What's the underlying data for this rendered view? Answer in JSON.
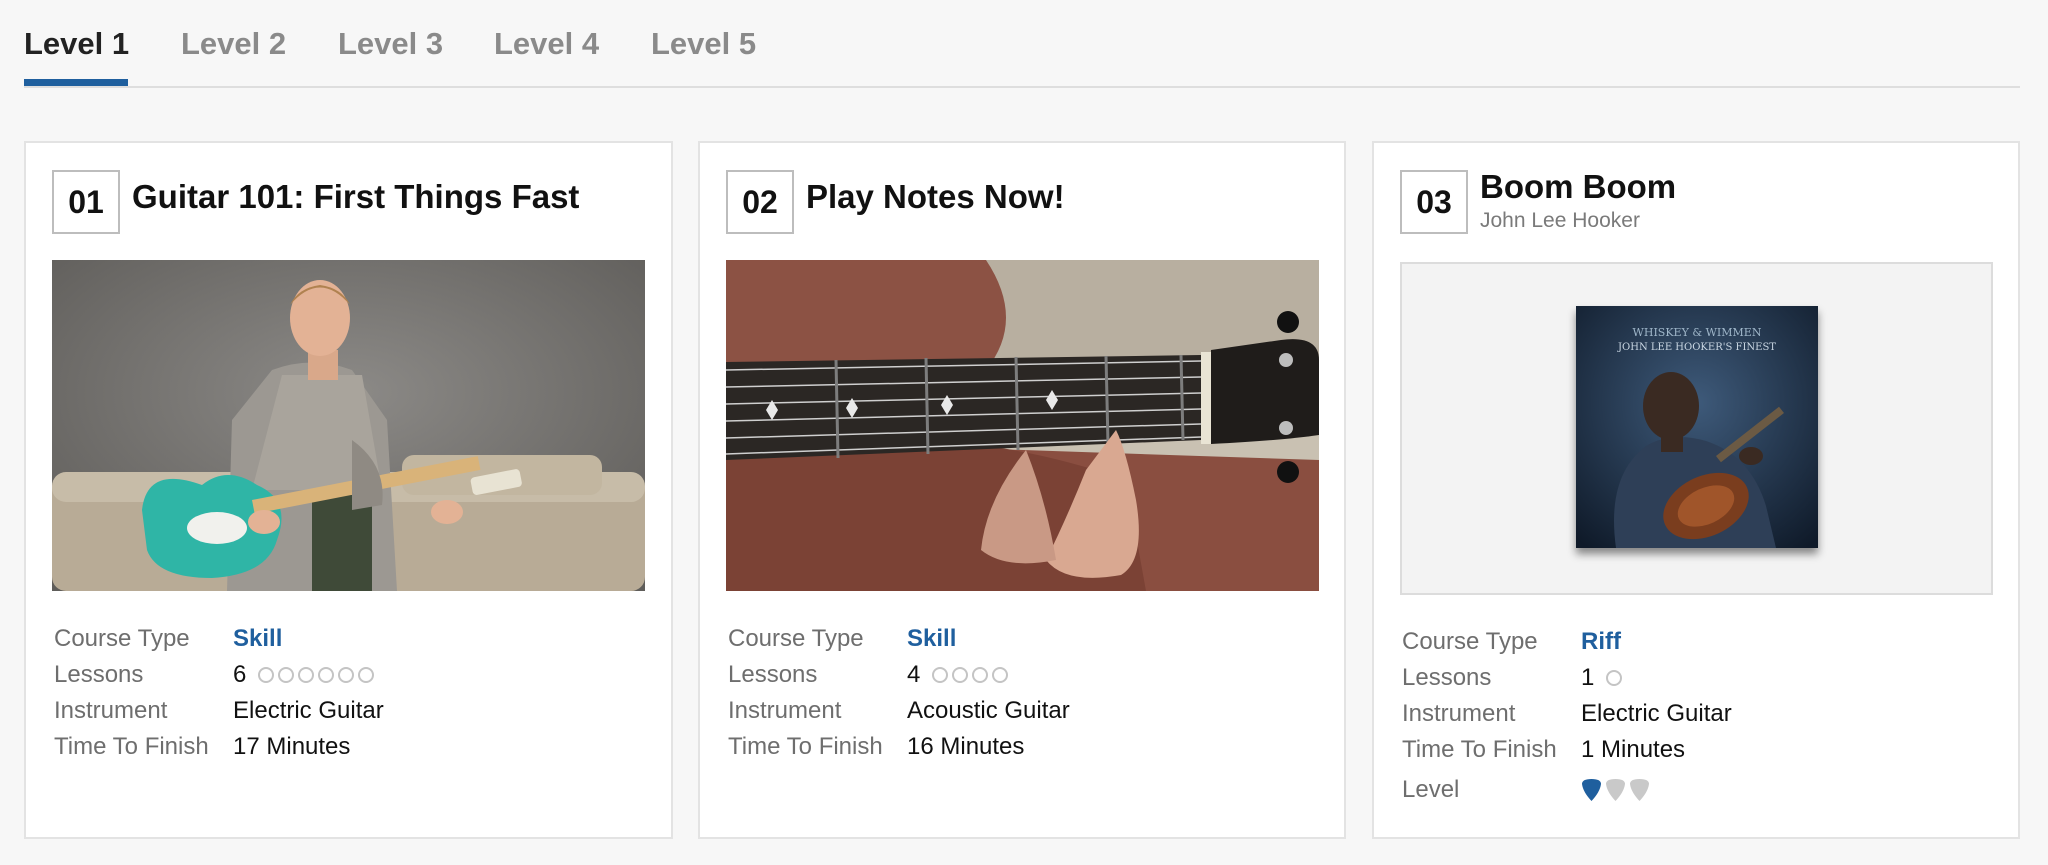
{
  "tabs": [
    {
      "label": "Level 1",
      "active": true
    },
    {
      "label": "Level 2",
      "active": false
    },
    {
      "label": "Level 3",
      "active": false
    },
    {
      "label": "Level 4",
      "active": false
    },
    {
      "label": "Level 5",
      "active": false
    }
  ],
  "colors": {
    "accent": "#1f5f9e",
    "pick_inactive": "#c9c9c9",
    "dot_border": "#c4c4c4"
  },
  "labels": {
    "course_type": "Course Type",
    "lessons": "Lessons",
    "instrument": "Instrument",
    "time_to_finish": "Time To Finish",
    "level": "Level"
  },
  "cards": [
    {
      "number": "01",
      "title": "Guitar 101: First Things Fast",
      "image": "instructor-with-teal-electric-guitar",
      "course_type": "Skill",
      "lessons": "6",
      "lesson_count": 6,
      "instrument": "Electric Guitar",
      "time": "17 Minutes"
    },
    {
      "number": "02",
      "title": "Play Notes Now!",
      "image": "acoustic-guitar-neck-closeup",
      "course_type": "Skill",
      "lessons": "4",
      "lesson_count": 4,
      "instrument": "Acoustic Guitar",
      "time": "16 Minutes"
    },
    {
      "number": "03",
      "title": "Boom Boom",
      "subtitle": "John Lee Hooker",
      "image": "album-cover",
      "album_text_line1": "WHISKEY & WIMMEN",
      "album_text_line2": "JOHN LEE HOOKER'S FINEST",
      "course_type": "Riff",
      "lessons": "1",
      "lesson_count": 1,
      "instrument": "Electric Guitar",
      "time": "1 Minutes",
      "level_picks": {
        "filled": 1,
        "total": 3,
        "icon": "guitar-pick-icon"
      }
    }
  ]
}
